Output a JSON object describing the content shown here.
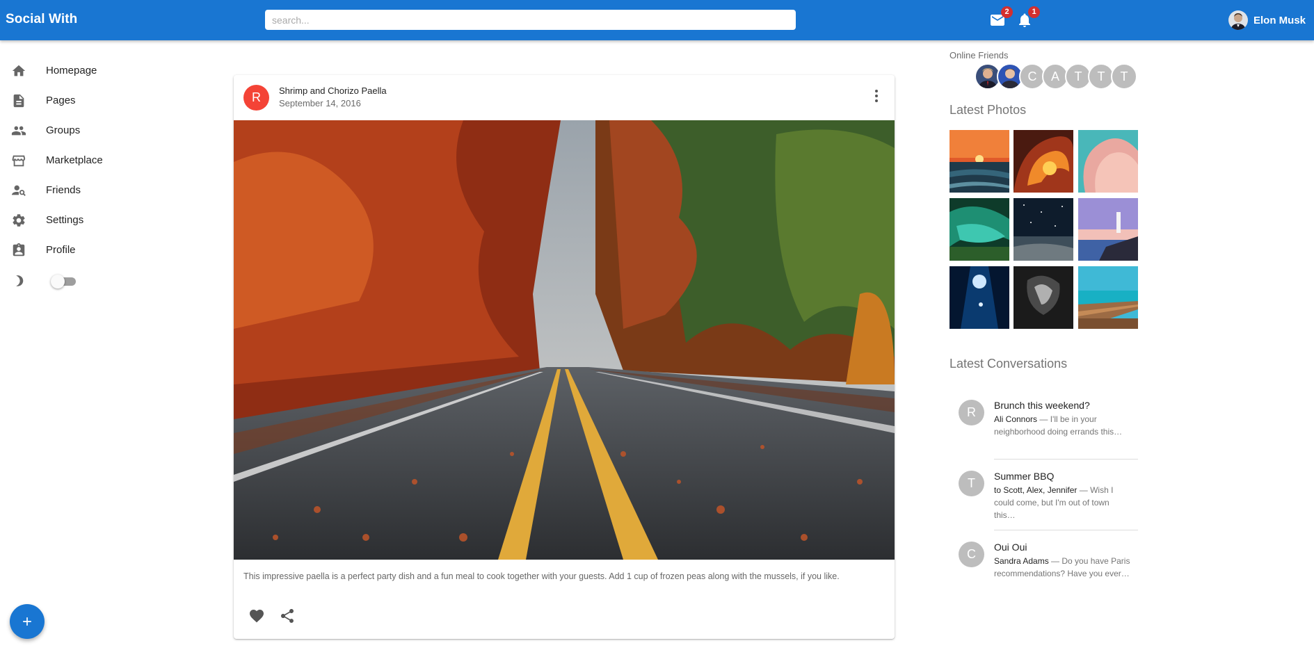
{
  "appbar": {
    "brand": "Social With",
    "search_placeholder": "search...",
    "mail_count": "2",
    "notification_count": "1",
    "user_name": "Elon Musk"
  },
  "sidebar": {
    "items": [
      {
        "label": "Homepage",
        "icon": "home-icon"
      },
      {
        "label": "Pages",
        "icon": "article-icon"
      },
      {
        "label": "Groups",
        "icon": "group-icon"
      },
      {
        "label": "Marketplace",
        "icon": "storefront-icon"
      },
      {
        "label": "Friends",
        "icon": "person-search-icon"
      },
      {
        "label": "Settings",
        "icon": "gear-icon"
      },
      {
        "label": "Profile",
        "icon": "badge-icon"
      }
    ],
    "theme_toggle": {
      "icon": "moon-icon",
      "state": "off"
    }
  },
  "fab": {
    "icon": "add-icon"
  },
  "post": {
    "avatar_letter": "R",
    "title": "Shrimp and Chorizo Paella",
    "date": "September 14, 2016",
    "image": "autumn road lined with red and orange trees",
    "text": "This impressive paella is a perfect party dish and a fun meal to cook together with your guests. Add 1 cup of frozen peas along with the mussels, if you like.",
    "actions": [
      "favorite-icon",
      "share-icon"
    ]
  },
  "online_friends": {
    "title": "Online Friends",
    "avatars": [
      "photo",
      "photo",
      "C",
      "A",
      "T",
      "T",
      "T"
    ]
  },
  "latest_photos": {
    "title": "Latest Photos",
    "photos": [
      "sunset over sea",
      "ocean wave at sunset",
      "pink coral",
      "green reef",
      "starry night beach",
      "lighthouse at dusk",
      "underwater diver",
      "dark cave",
      "wooden pier"
    ]
  },
  "latest_conversations": {
    "title": "Latest Conversations",
    "items": [
      {
        "avatar": "R",
        "subject": "Brunch this weekend?",
        "from": "Ali Connors",
        "snippet": " — I'll be in your neighborhood doing errands this…"
      },
      {
        "avatar": "T",
        "subject": "Summer BBQ",
        "from": "to Scott, Alex, Jennifer",
        "snippet": " — Wish I could come, but I'm out of town this…"
      },
      {
        "avatar": "C",
        "subject": "Oui Oui",
        "from": "Sandra Adams",
        "snippet": " — Do you have Paris recommendations? Have you ever…"
      }
    ]
  },
  "colors": {
    "primary": "#1976d2",
    "badge": "#d32f2f",
    "post_avatar": "#f44336",
    "avatar_grey": "#bdbdbd"
  }
}
